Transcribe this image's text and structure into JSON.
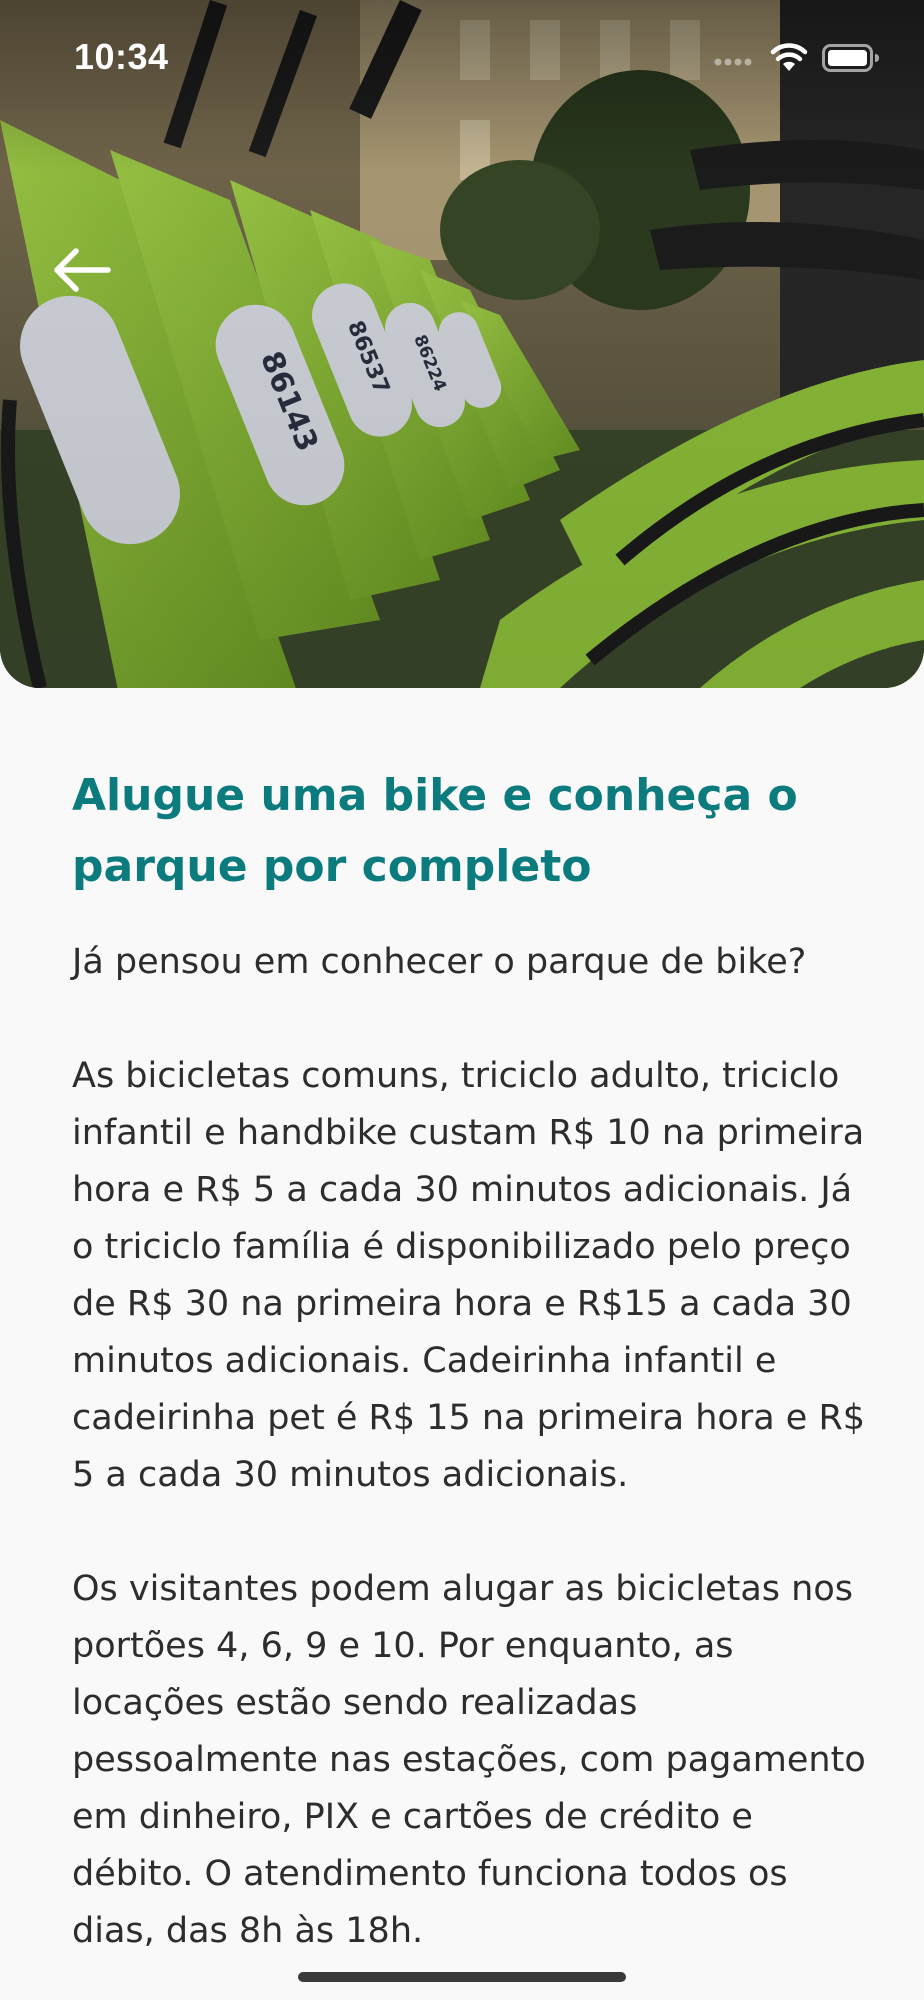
{
  "status_bar": {
    "time": "10:34",
    "icons": [
      "signal-icon",
      "wifi-icon",
      "battery-icon"
    ]
  },
  "header": {
    "back_icon": "arrow-left-icon",
    "hero_image": "bike-rental-photo",
    "bike_numbers": [
      "86143",
      "86537",
      "86224"
    ]
  },
  "article": {
    "title": "Alugue uma bike e conheça o parque por completo",
    "paragraphs": [
      "Já pensou em conhecer o parque de bike?",
      "As bicicletas comuns, triciclo adulto, triciclo infantil e handbike custam R$ 10 na primeira hora e R$ 5 a cada 30 minutos adicionais. Já o triciclo família é disponibilizado pelo preço de R$ 30 na primeira hora e R$15 a cada 30 minutos adicionais. Cadeirinha infantil e cadeirinha pet é R$ 15 na primeira hora e R$ 5 a cada 30 minutos adicionais.",
      "Os visitantes podem alugar as bicicletas nos portões 4, 6, 9 e 10. Por enquanto, as locações estão sendo realizadas pessoalmente nas estações, com pagamento em dinheiro, PIX e cartões de crédito e débito. O atendimento funciona todos os dias, das 8h às 18h."
    ]
  },
  "colors": {
    "title": "#0b7b7e",
    "body_text": "#2d2d2d",
    "background": "#f9f9f9",
    "bike_green": "#8cc43a"
  }
}
